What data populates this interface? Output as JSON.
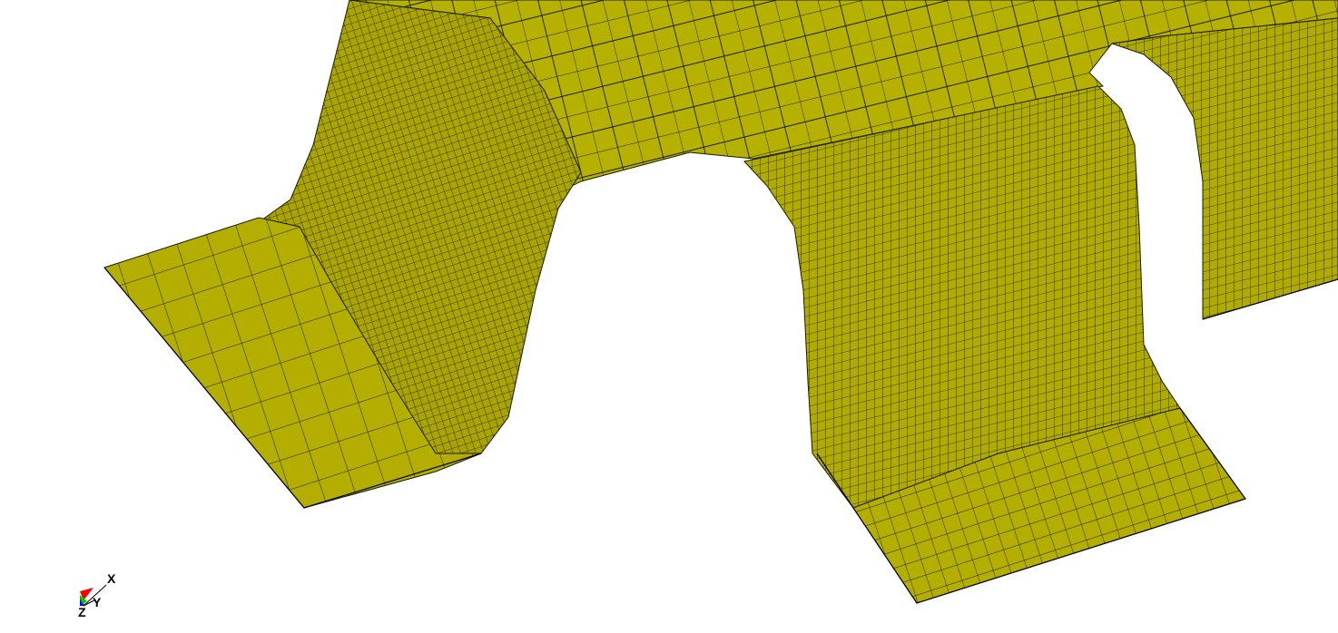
{
  "scene": {
    "background": "#ffffff",
    "mesh_fill": "#b3ae00",
    "mesh_line": "#1a1a00"
  },
  "triad": {
    "x_label": "X",
    "y_label": "Y",
    "z_label": "Z",
    "x_color": "#ff0000",
    "y_color": "#00cc00",
    "z_color": "#0000ff"
  }
}
